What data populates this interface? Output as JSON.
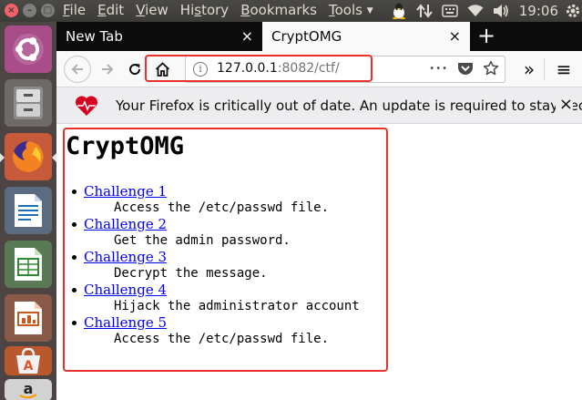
{
  "window": {
    "close_glyph": "×",
    "min_glyph": "–",
    "max_glyph": "□"
  },
  "menubar": {
    "items": [
      {
        "accel": "F",
        "rest": "ile"
      },
      {
        "accel": "E",
        "rest": "dit"
      },
      {
        "accel": "V",
        "rest": "iew"
      },
      {
        "accel": "",
        "pre": "Hi",
        "accel2": "s",
        "rest": "tory"
      },
      {
        "accel": "B",
        "rest": "ookmarks"
      },
      {
        "accel": "T",
        "rest": "ools"
      }
    ],
    "tools_dropdown": "▼"
  },
  "tray": {
    "icons": [
      "tux-icon",
      "network-updown-icon",
      "keyboard-input-icon",
      "wifi-icon",
      "volume-icon"
    ],
    "clock": "19:06"
  },
  "launcher": {
    "items": [
      "ubuntu-dash",
      "files",
      "firefox",
      "libreoffice-writer",
      "libreoffice-calc",
      "libreoffice-impress",
      "ubuntu-software",
      "amazon"
    ],
    "active": "firefox"
  },
  "tabs": [
    {
      "label": "New Tab",
      "close": "×"
    },
    {
      "label": "CryptOMG",
      "close": "×"
    }
  ],
  "new_tab": "+",
  "url": {
    "host": "127.0.0.1",
    "rest": ":8082/ctf/",
    "info_glyph": "i",
    "more_glyph": "•••"
  },
  "toolbar": {
    "overflow_glyph": "»",
    "menu_glyph": "≡"
  },
  "notification": {
    "text": "Your Firefox is critically out of date. An update is required to stay secur",
    "close": "×"
  },
  "page": {
    "title": "CryptOMG",
    "challenges": [
      {
        "link": "Challenge 1",
        "desc": "Access the /etc/passwd file."
      },
      {
        "link": "Challenge 2",
        "desc": "Get the admin password."
      },
      {
        "link": "Challenge 3",
        "desc": "Decrypt the message."
      },
      {
        "link": "Challenge 4",
        "desc": "Hijack the administrator account"
      },
      {
        "link": "Challenge 5",
        "desc": "Access the /etc/passwd file."
      }
    ]
  },
  "colors": {
    "highlight_red": "#e8312a",
    "link_blue": "#0000ee",
    "panel_dark": "#3c3b37",
    "launcher_bg": "#4d4543",
    "tabbar_bg": "#0c0c0d"
  }
}
